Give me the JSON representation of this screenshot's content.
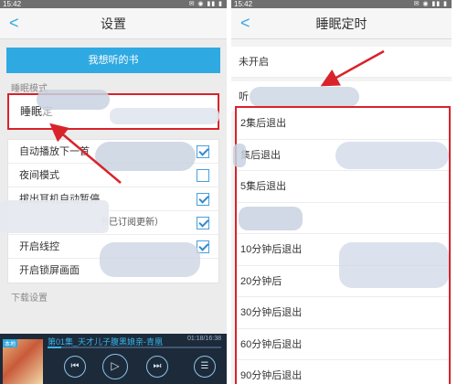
{
  "left": {
    "status_time": "15:42",
    "title": "设置",
    "back_glyph": "<",
    "wish_button": "我想听的书",
    "sleep_section": "睡眠模式",
    "sleep_mode_label": "睡眠",
    "sleep_mode_value": "定",
    "rows": [
      {
        "label": "自动播放下一首",
        "checked": true
      },
      {
        "label": "夜间模式",
        "checked": false
      },
      {
        "label": "拔出耳机自动暂停",
        "checked": true
      },
      {
        "label": "",
        "hint": "书已订阅更新）",
        "checked": true
      },
      {
        "label": "开启线控",
        "checked": true
      },
      {
        "label": "开启锁屏画面",
        "checked": false
      }
    ],
    "download_section": "下载设置",
    "player": {
      "cover_tag": "本地",
      "episode": "第01集_天才儿子腹黑娘亲-青凰",
      "time": "01:18/16:38",
      "progress": 0.08,
      "prev_glyph": "⏮",
      "play_glyph": "▷",
      "next_glyph": "⏭",
      "list_glyph": "☰"
    }
  },
  "right": {
    "status_time": "15:42",
    "title": "睡眠定时",
    "back_glyph": "<",
    "off_option": "未开启",
    "listen_option": "听",
    "timer_options": [
      "2集后退出",
      "集后退出",
      "5集后退出",
      "",
      "10分钟后退出",
      "20分钟后",
      "30分钟后退出",
      "60分钟后退出",
      "90分钟后退出"
    ]
  },
  "colors": {
    "accent": "#2fa9e1",
    "highlight_box": "#d9232a",
    "arrow": "#d9232a"
  }
}
